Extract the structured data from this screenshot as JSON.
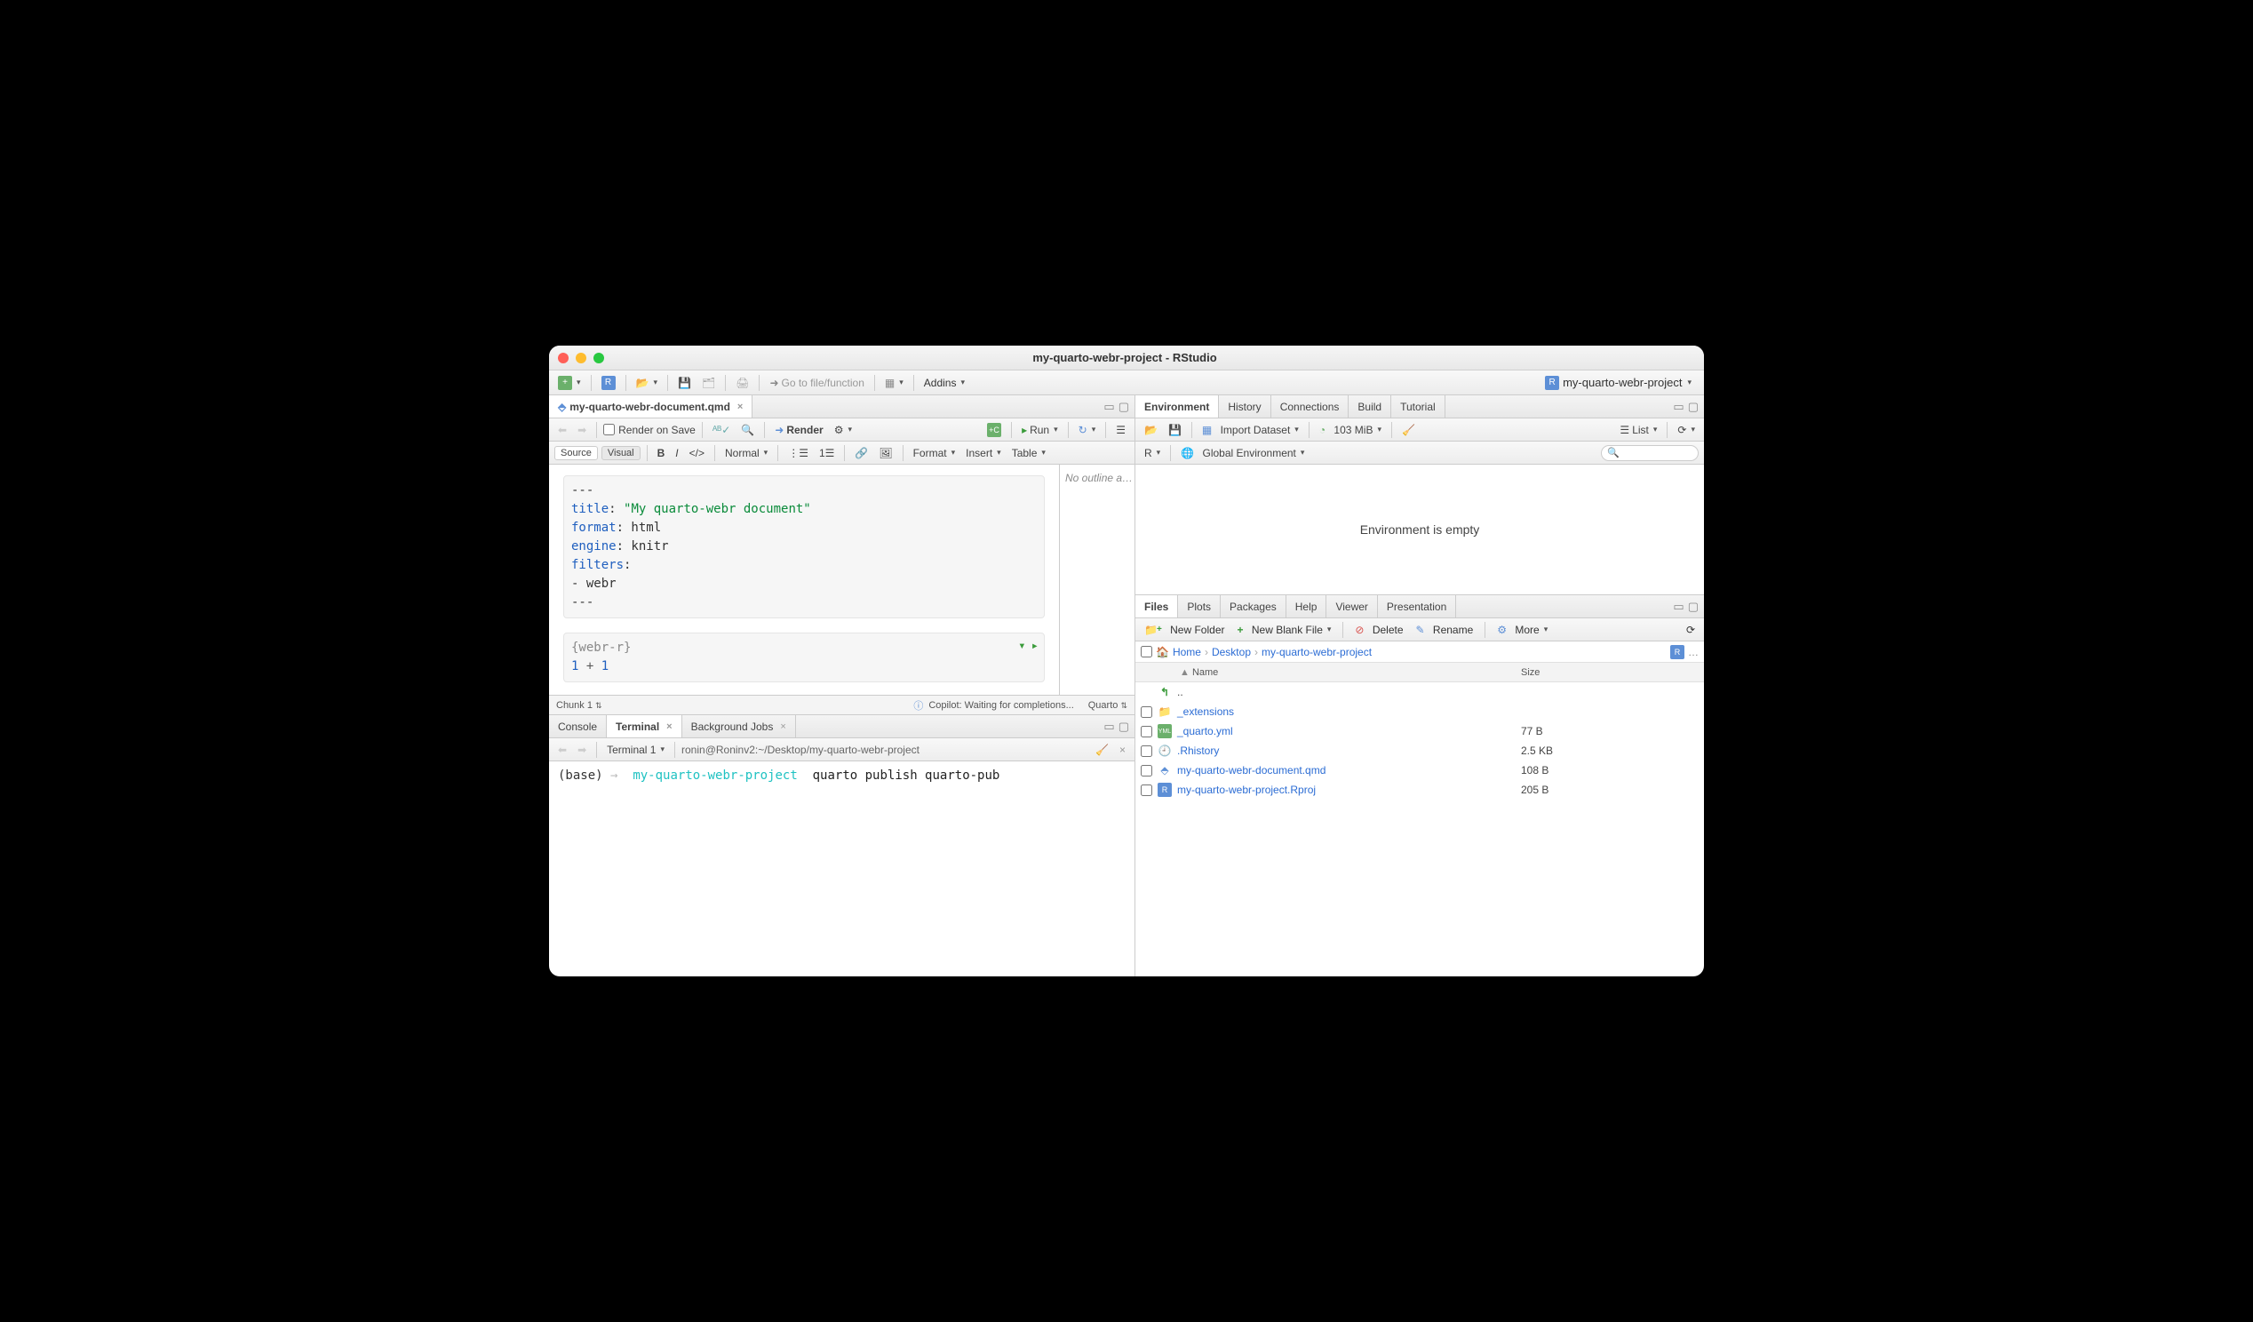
{
  "title": "my-quarto-webr-project - RStudio",
  "project_name": "my-quarto-webr-project",
  "main_toolbar": {
    "goto_placeholder": "Go to file/function",
    "addins": "Addins"
  },
  "source": {
    "tab": "my-quarto-webr-document.qmd",
    "render_on_save": "Render on Save",
    "render": "Render",
    "run": "Run",
    "source_label": "Source",
    "visual_label": "Visual",
    "normal": "Normal",
    "format": "Format",
    "insert": "Insert",
    "table": "Table",
    "outline": "No outline a…",
    "yaml": {
      "l1": "---",
      "l2a": "title",
      "l2b": ": ",
      "l2c": "\"My quarto-webr document\"",
      "l3a": "format",
      "l3b": ": html",
      "l4a": "engine",
      "l4b": ": knitr",
      "l5a": "filters",
      "l5b": ":",
      "l6": "  - webr",
      "l7": "---"
    },
    "chunk": {
      "header": "{webr-r}",
      "code_a": "1 ",
      "code_b": "+",
      "code_c": " 1"
    },
    "status_left": "Chunk 1",
    "status_copilot": "Copilot: Waiting for completions...",
    "status_quarto": "Quarto"
  },
  "console": {
    "tabs": {
      "console": "Console",
      "terminal": "Terminal",
      "jobs": "Background Jobs"
    },
    "term_label": "Terminal 1",
    "cwd": "ronin@Roninv2:~/Desktop/my-quarto-webr-project",
    "prompt_base": "(base)",
    "prompt_arrow": "→",
    "prompt_dir": "my-quarto-webr-project",
    "cmd": "quarto publish quarto-pub"
  },
  "env": {
    "tabs": {
      "environment": "Environment",
      "history": "History",
      "connections": "Connections",
      "build": "Build",
      "tutorial": "Tutorial"
    },
    "import": "Import Dataset",
    "mem": "103 MiB",
    "list": "List",
    "scope_r": "R",
    "scope_global": "Global Environment",
    "empty": "Environment is empty"
  },
  "files": {
    "tabs": {
      "files": "Files",
      "plots": "Plots",
      "packages": "Packages",
      "help": "Help",
      "viewer": "Viewer",
      "presentation": "Presentation"
    },
    "new_folder": "New Folder",
    "new_blank": "New Blank File",
    "delete": "Delete",
    "rename": "Rename",
    "more": "More",
    "crumbs": {
      "home": "Home",
      "desktop": "Desktop",
      "proj": "my-quarto-webr-project"
    },
    "cols": {
      "name": "Name",
      "size": "Size"
    },
    "up": "..",
    "rows": [
      {
        "name": "_extensions",
        "size": "",
        "icon": "folder"
      },
      {
        "name": "_quarto.yml",
        "size": "77 B",
        "icon": "yml"
      },
      {
        "name": ".Rhistory",
        "size": "2.5 KB",
        "icon": "rhist"
      },
      {
        "name": "my-quarto-webr-document.qmd",
        "size": "108 B",
        "icon": "qmd"
      },
      {
        "name": "my-quarto-webr-project.Rproj",
        "size": "205 B",
        "icon": "rproj"
      }
    ]
  }
}
